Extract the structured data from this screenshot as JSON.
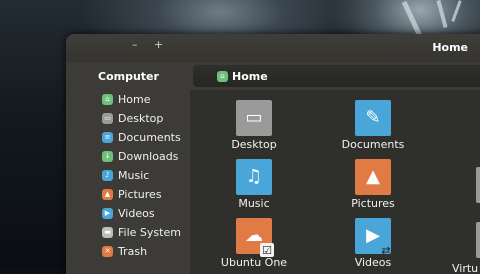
{
  "window": {
    "title": "Home",
    "minimize_glyph": "–",
    "maximize_glyph": "+"
  },
  "sidebar": {
    "header": "Computer",
    "items": [
      {
        "label": "Home",
        "icon": "home-folder-icon",
        "color": "#6ec17a",
        "glyph": "⌂"
      },
      {
        "label": "Desktop",
        "icon": "desktop-folder-icon",
        "color": "#9a9a9a",
        "glyph": "▭"
      },
      {
        "label": "Documents",
        "icon": "documents-folder-icon",
        "color": "#4aa6d8",
        "glyph": "≡"
      },
      {
        "label": "Downloads",
        "icon": "downloads-folder-icon",
        "color": "#6ec17a",
        "glyph": "↓"
      },
      {
        "label": "Music",
        "icon": "music-folder-icon",
        "color": "#4aa6d8",
        "glyph": "♪"
      },
      {
        "label": "Pictures",
        "icon": "pictures-folder-icon",
        "color": "#e07b45",
        "glyph": "▲"
      },
      {
        "label": "Videos",
        "icon": "videos-folder-icon",
        "color": "#4aa6d8",
        "glyph": "▶"
      },
      {
        "label": "File System",
        "icon": "harddrive-icon",
        "color": "#bdbdbd",
        "glyph": "▬"
      },
      {
        "label": "Trash",
        "icon": "trash-icon",
        "color": "#e07b45",
        "glyph": "✕"
      }
    ]
  },
  "pathbar": {
    "label": "Home",
    "icon": "home-folder-icon"
  },
  "files": [
    {
      "label": "Desktop",
      "icon": "desktop-folder-icon",
      "color": "#9a9a9a",
      "glyph": "▭"
    },
    {
      "label": "Documents",
      "icon": "documents-folder-icon",
      "color": "#4aa6d8",
      "glyph": "✎"
    },
    {
      "label": "Music",
      "icon": "music-folder-icon",
      "color": "#4aa6d8",
      "glyph": "♫"
    },
    {
      "label": "Pictures",
      "icon": "pictures-folder-icon",
      "color": "#e07b45",
      "glyph": "▲"
    },
    {
      "label": "Ubuntu One",
      "icon": "ubuntu-one-folder-icon",
      "color": "#e07b45",
      "glyph": "☁",
      "emblem": "☑",
      "emblem_name": "synced-emblem-icon"
    },
    {
      "label": "Videos",
      "icon": "videos-folder-icon",
      "color": "#4aa6d8",
      "glyph": "▶",
      "emblem": "⇄",
      "emblem_name": "shared-emblem-icon"
    },
    {
      "label": "Virtu",
      "icon": "folder-icon",
      "color": "#9a9a9a",
      "glyph": ""
    }
  ],
  "colors": {
    "window_bg": "#3c3b37",
    "main_bg": "#2f2f2b",
    "text": "#f2f2f2",
    "accent_orange": "#e07b45",
    "accent_blue": "#4aa6d8",
    "accent_green": "#6ec17a"
  }
}
